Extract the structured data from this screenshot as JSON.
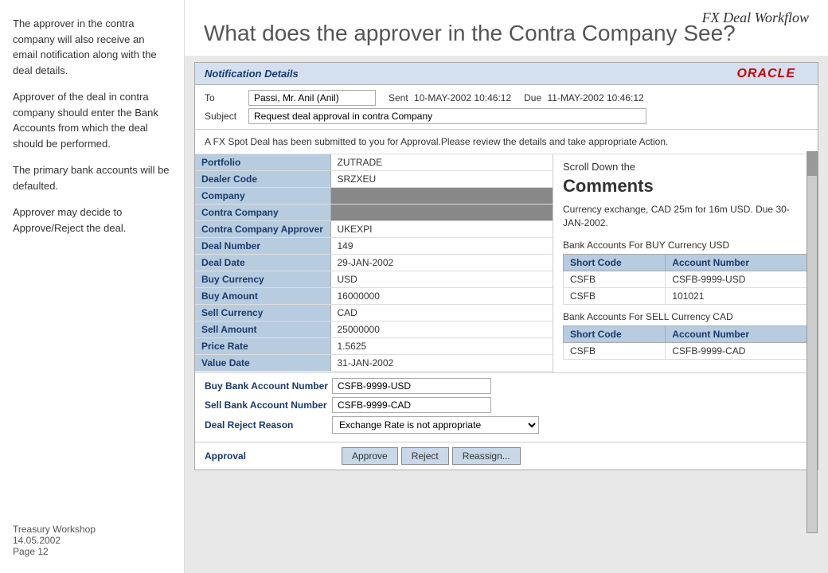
{
  "brand": "FX Deal Workflow",
  "oracle": "ORACLE",
  "title": "What does the approver in the Contra Company See?",
  "sidebar": {
    "paragraphs": [
      "The approver in the contra company will also receive an email notification along with the deal details.",
      "Approver of the deal in contra company should enter the Bank Accounts from which the deal should be performed.",
      "The primary bank accounts will be defaulted.",
      "Approver may decide to Approve/Reject the deal."
    ],
    "footer_line1": "Treasury Workshop",
    "footer_line2": "14.05.2002",
    "footer_line3": "Page 12"
  },
  "notification": {
    "header": "Notification Details",
    "to_label": "To",
    "to_value": "Passi, Mr. Anil (Anil)",
    "sent_label": "Sent",
    "sent_value": "10-MAY-2002 10:46:12",
    "due_label": "Due",
    "due_value": "11-MAY-2002 10:46:12",
    "subject_label": "Subject",
    "subject_value": "Request deal approval in contra Company",
    "message": "A FX Spot Deal has been submitted to you for Approval.Please review the details and take appropriate Action."
  },
  "deal_fields": [
    {
      "label": "Portfolio",
      "value": "ZUTRADE"
    },
    {
      "label": "Dealer Code",
      "value": "SRZXEU"
    },
    {
      "label": "Company",
      "value": ""
    },
    {
      "label": "Contra Company",
      "value": ""
    },
    {
      "label": "Contra Company Approver",
      "value": "UKEXPI"
    },
    {
      "label": "Deal Number",
      "value": "149"
    },
    {
      "label": "Deal Date",
      "value": "29-JAN-2002"
    },
    {
      "label": "Buy Currency",
      "value": "USD"
    },
    {
      "label": "Buy Amount",
      "value": "16000000"
    },
    {
      "label": "Sell Currency",
      "value": "CAD"
    },
    {
      "label": "Sell Amount",
      "value": "25000000"
    },
    {
      "label": "Price Rate",
      "value": "1.5625"
    },
    {
      "label": "Value Date",
      "value": "31-JAN-2002"
    }
  ],
  "right_panel": {
    "scroll_label": "Scroll Down the",
    "comments_heading": "Comments",
    "comments_text": "Currency exchange, CAD 25m for 16m USD. Due 30-JAN-2002.",
    "buy_section_title": "Bank Accounts For BUY Currency USD",
    "buy_table": {
      "col1": "Short Code",
      "col2": "Account Number",
      "rows": [
        {
          "short_code": "CSFB",
          "account_number": "CSFB-9999-USD"
        },
        {
          "short_code": "CSFB",
          "account_number": "101021"
        }
      ]
    },
    "sell_section_title": "Bank Accounts For SELL Currency CAD",
    "sell_table": {
      "col1": "Short Code",
      "col2": "Account Number",
      "rows": [
        {
          "short_code": "CSFB",
          "account_number": "CSFB-9999-CAD"
        }
      ]
    }
  },
  "bottom_fields": [
    {
      "label": "Buy Bank Account Number",
      "value": "CSFB-9999-USD"
    },
    {
      "label": "Sell Bank Account Number",
      "value": "CSFB-9999-CAD"
    },
    {
      "label": "Deal Reject Reason",
      "value": "Exchange Rate is not appropriate",
      "is_select": true
    }
  ],
  "action_buttons": {
    "label": "Approval",
    "buttons": [
      "Approve",
      "Reject",
      "Reassign..."
    ]
  }
}
